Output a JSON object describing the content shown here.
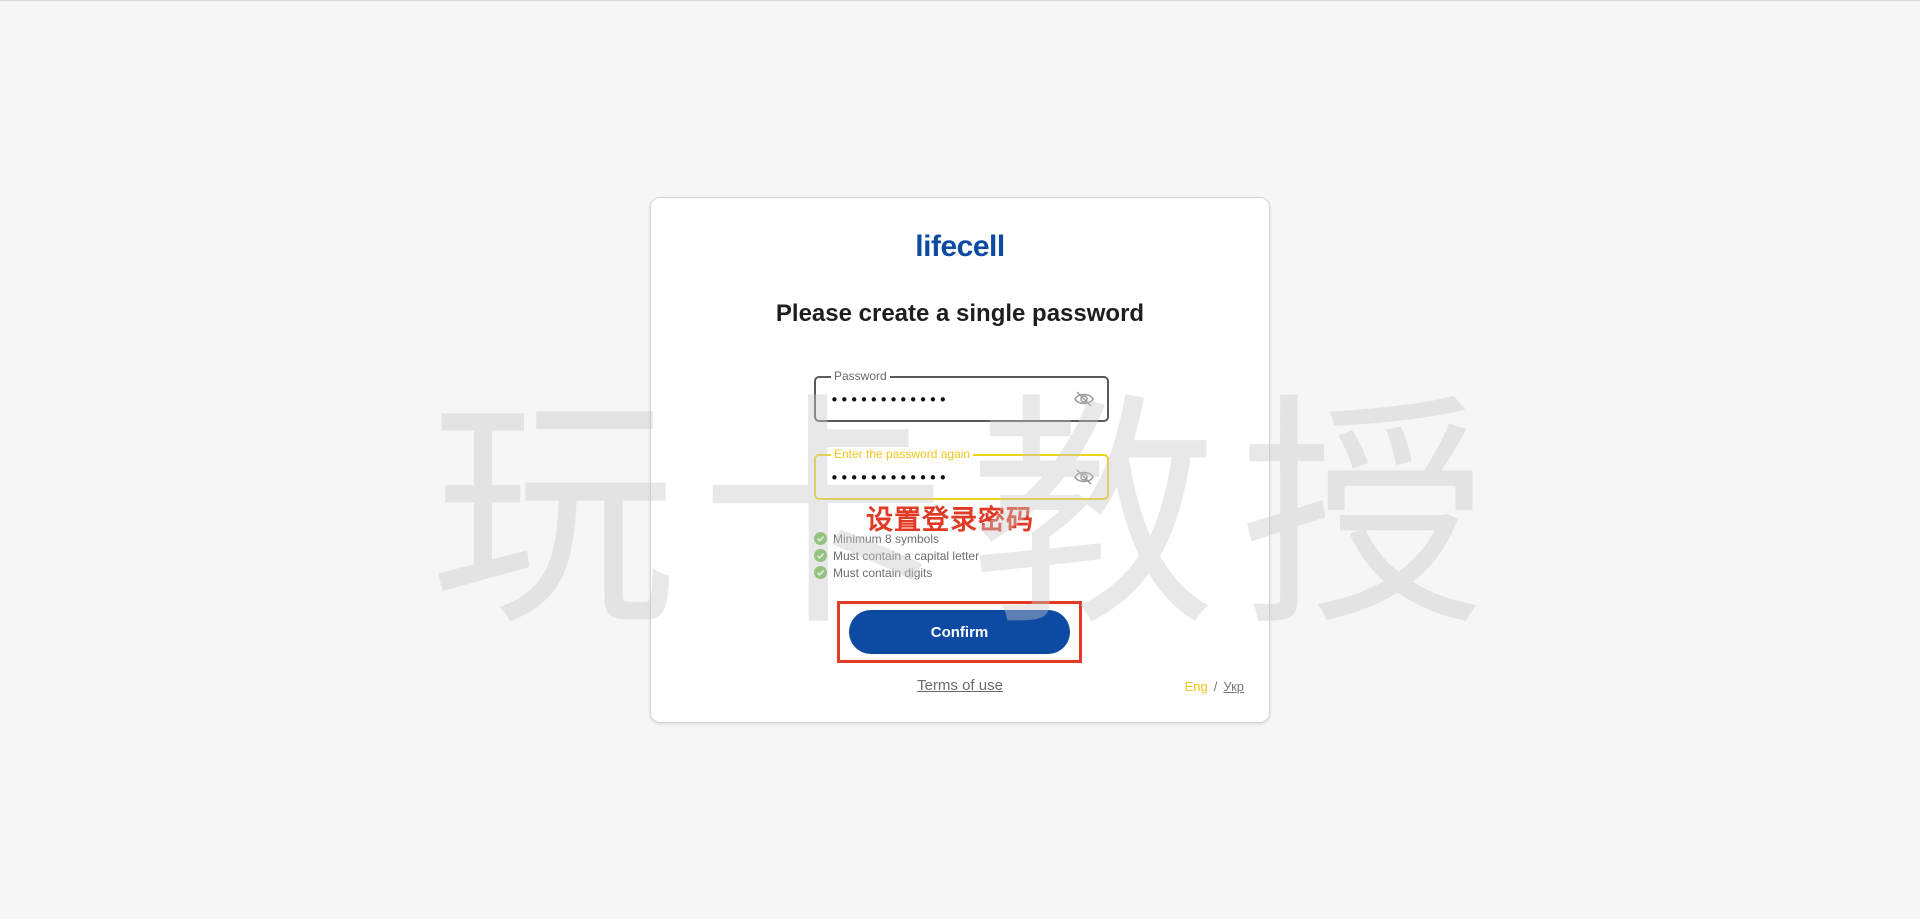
{
  "brand": {
    "logo_text": "lifecell",
    "color": "#0d4aa2"
  },
  "page": {
    "title": "Please create a single password"
  },
  "password": {
    "label": "Password",
    "value": "••••••••••••",
    "toggle_icon": "eye-off-icon"
  },
  "password_repeat": {
    "label": "Enter the password again",
    "value": "••••••••••••",
    "toggle_icon": "eye-off-icon"
  },
  "annotation": {
    "text": "设置登录密码",
    "color": "#e03a24"
  },
  "requirements": [
    {
      "text": "Minimum 8 symbols",
      "status": "met",
      "icon": "check-circle-icon"
    },
    {
      "text": "Must contain a capital letter",
      "status": "met",
      "icon": "check-circle-icon"
    },
    {
      "text": "Must contain digits",
      "status": "met",
      "icon": "check-circle-icon"
    }
  ],
  "actions": {
    "confirm_label": "Confirm"
  },
  "footer": {
    "terms_label": "Terms of use",
    "lang_eng": "Eng",
    "lang_separator": "/",
    "lang_ukr": "Укр"
  },
  "watermark": {
    "text": "玩卡教授"
  },
  "colors": {
    "accent": "#0d4aa2",
    "focus_border": "#f2d31b",
    "success": "#6cc04a",
    "highlight": "#e23a25"
  }
}
